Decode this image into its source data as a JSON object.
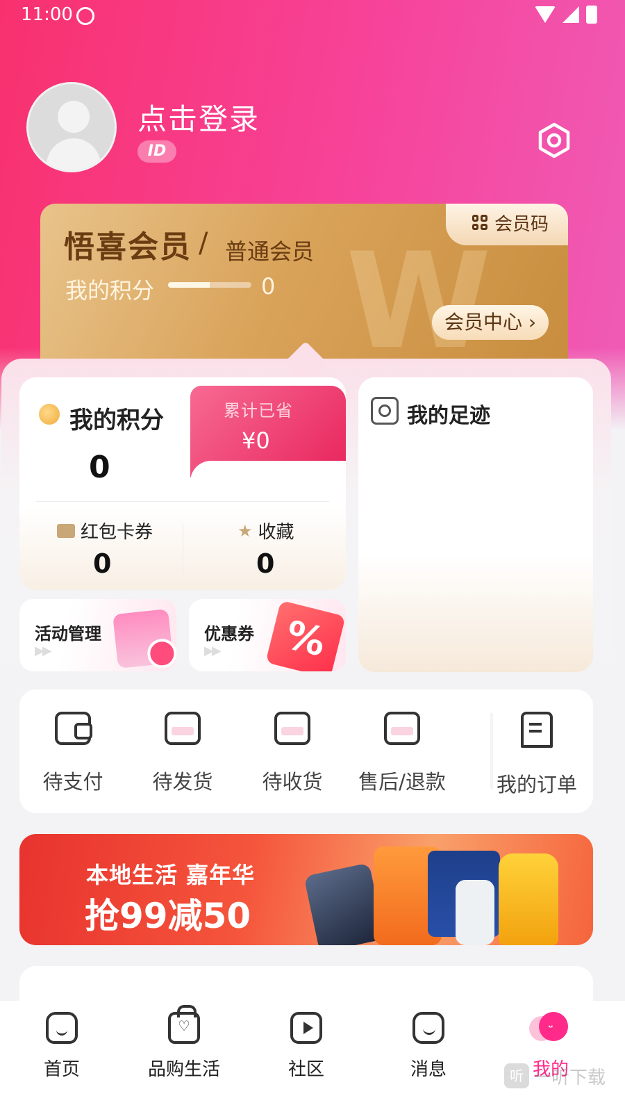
{
  "status_bar": {
    "time": "11:00"
  },
  "profile": {
    "login_text": "点击登录",
    "id_badge": "ID"
  },
  "member_card": {
    "brand": "悟喜会员",
    "slash": "/",
    "level": "普通会员",
    "points_label": "我的积分",
    "points_value": "0",
    "points_progress": 0.5,
    "code_button": "会员码",
    "center_button": "会员中心 ›"
  },
  "points_card": {
    "title": "我的积分",
    "value": "0",
    "saved_label": "累计已省",
    "saved_value": "¥0",
    "coupons_label": "红包卡券",
    "coupons_value": "0",
    "favorites_label": "收藏",
    "favorites_value": "0"
  },
  "footprint": {
    "title": "我的足迹"
  },
  "mini_cards": {
    "activity": "活动管理",
    "coupon": "优惠券",
    "arrows": "▶▶"
  },
  "orders": {
    "items": [
      {
        "label": "待支付",
        "icon": "wallet-icon"
      },
      {
        "label": "待发货",
        "icon": "box-icon"
      },
      {
        "label": "待收货",
        "icon": "box-check-icon"
      },
      {
        "label": "售后/退款",
        "icon": "return-icon"
      }
    ],
    "all_label": "我的订单"
  },
  "banner": {
    "line1": "本地生活 嘉年华",
    "line2": "抢99减50"
  },
  "tabbar": {
    "items": [
      {
        "label": "首页",
        "icon": "home-icon"
      },
      {
        "label": "品购生活",
        "icon": "shopping-bag-icon"
      },
      {
        "label": "社区",
        "icon": "play-icon"
      },
      {
        "label": "消息",
        "icon": "message-icon"
      },
      {
        "label": "我的",
        "icon": "profile-face-icon"
      }
    ]
  },
  "watermark": {
    "logo": "听",
    "text": "一听下载"
  },
  "colors": {
    "brand_pink": "#ff2a8a",
    "header_start": "#f8316e",
    "gold": "#d9a35a"
  }
}
